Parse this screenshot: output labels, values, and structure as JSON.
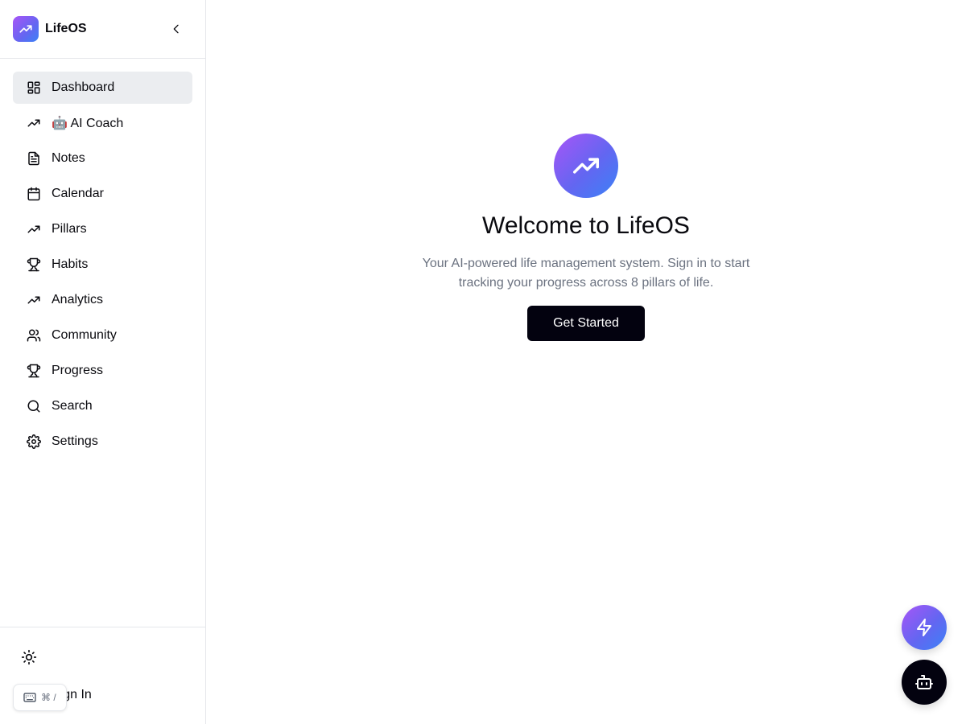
{
  "brand": {
    "name": "LifeOS",
    "logo_icon": "trending-up-icon"
  },
  "sidebar": {
    "items": [
      {
        "label": "Dashboard",
        "icon": "dashboard-grid-icon",
        "active": true
      },
      {
        "label": "🤖 AI Coach",
        "icon": "trending-up-icon"
      },
      {
        "label": "Notes",
        "icon": "document-icon"
      },
      {
        "label": "Calendar",
        "icon": "calendar-icon"
      },
      {
        "label": "Pillars",
        "icon": "trending-up-icon"
      },
      {
        "label": "Habits",
        "icon": "trophy-icon"
      },
      {
        "label": "Analytics",
        "icon": "trending-up-icon"
      },
      {
        "label": "Community",
        "icon": "users-icon"
      },
      {
        "label": "Progress",
        "icon": "trophy-icon"
      },
      {
        "label": "Search",
        "icon": "search-icon"
      },
      {
        "label": "Settings",
        "icon": "gear-icon"
      }
    ],
    "bottom": {
      "theme_icon": "sun-icon",
      "signin_label": "Sign In",
      "shortcut_hint": "⌘ /"
    }
  },
  "main": {
    "title": "Welcome to LifeOS",
    "subtitle": "Your AI-powered life management system. Sign in to start tracking your progress across 8 pillars of life.",
    "cta_label": "Get Started"
  },
  "colors": {
    "accent_gradient_start": "#a855f7",
    "accent_gradient_end": "#3b82f6",
    "primary_button": "#03020f",
    "active_nav_bg": "#ebedf0"
  }
}
